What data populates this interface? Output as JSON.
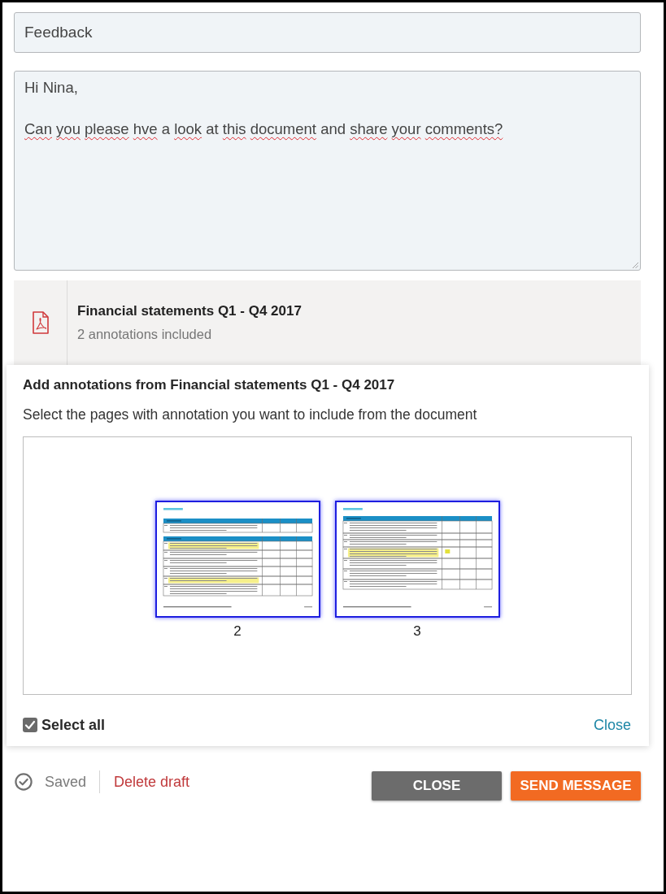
{
  "subject_field": {
    "value": "Feedback"
  },
  "message_field": {
    "paragraphs": [
      {
        "words": [
          {
            "text": "Hi",
            "flagged": false
          },
          {
            "text": "Nina,",
            "flagged": false
          }
        ]
      },
      {
        "words": [
          {
            "text": "Can",
            "flagged": true
          },
          {
            "text": "you",
            "flagged": true
          },
          {
            "text": "please",
            "flagged": true
          },
          {
            "text": "hve",
            "flagged": true
          },
          {
            "text": "a",
            "flagged": false
          },
          {
            "text": "look",
            "flagged": true
          },
          {
            "text": "at",
            "flagged": false
          },
          {
            "text": "this",
            "flagged": true
          },
          {
            "text": "document",
            "flagged": true
          },
          {
            "text": "and",
            "flagged": false
          },
          {
            "text": "share",
            "flagged": true
          },
          {
            "text": "your",
            "flagged": true
          },
          {
            "text": "comments?",
            "flagged": true
          }
        ]
      }
    ]
  },
  "attachment": {
    "title": "Financial statements Q1 - Q4 2017",
    "subtitle": "2 annotations included"
  },
  "annotation_panel": {
    "title": "Add annotations from Financial statements Q1 - Q4 2017",
    "instruction": "Select the pages with annotation you want to include from the document",
    "pages": [
      {
        "label": "2",
        "selected": true
      },
      {
        "label": "3",
        "selected": true
      }
    ],
    "select_all": {
      "label": "Select all",
      "checked": true
    },
    "close_link": "Close"
  },
  "footer": {
    "status": "Saved",
    "delete_link": "Delete draft",
    "buttons": [
      {
        "label": "CLOSE",
        "kind": "secondary"
      },
      {
        "label": "SEND MESSAGE",
        "kind": "primary"
      }
    ]
  }
}
